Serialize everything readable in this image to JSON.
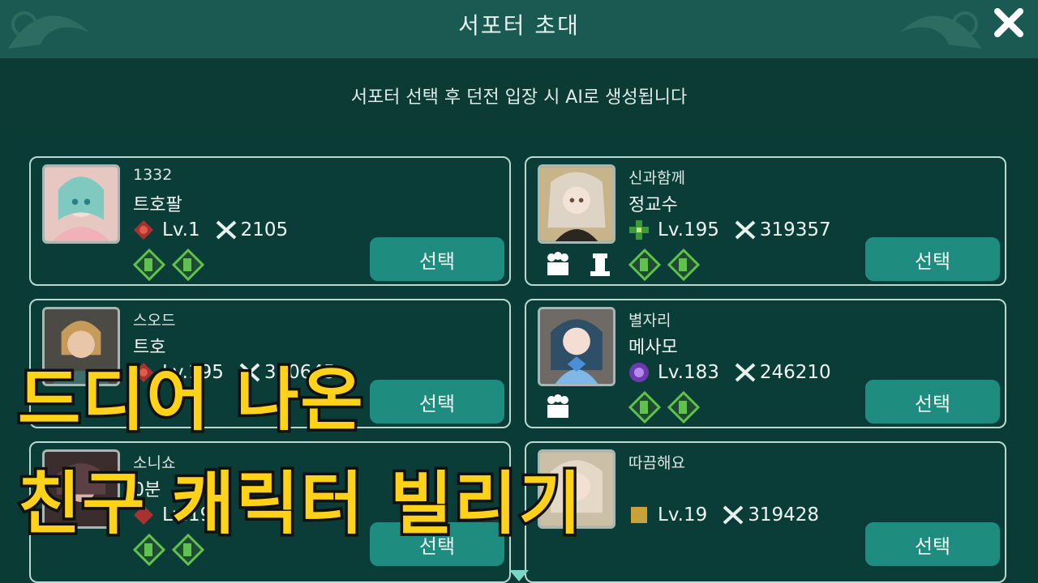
{
  "header": {
    "title": "서포터 초대",
    "close_icon": "close-icon"
  },
  "subtitle": "서포터 선택 후 던전 입장 시 AI로 생성됩니다",
  "cards": [
    {
      "guild": "1332",
      "name": "트호팔",
      "level": "Lv.1",
      "power": "2105",
      "select_label": "선택",
      "class_color": "#a8322f"
    },
    {
      "guild": "신과함께",
      "name": "정교수",
      "level": "Lv.195",
      "power": "319357",
      "select_label": "선택",
      "class_color": "#3c9a3a"
    },
    {
      "guild": "스오드",
      "name": "트호",
      "level": "Lv.195",
      "power": "310645",
      "select_label": "선택",
      "class_color": "#a8322f"
    },
    {
      "guild": "별자리",
      "name": "메사모",
      "level": "Lv.183",
      "power": "246210",
      "select_label": "선택",
      "class_color": "#6a3ab0"
    },
    {
      "guild": "소니쇼",
      "name": "0분",
      "level": "Lv.19",
      "power": "",
      "select_label": "선택",
      "class_color": "#a8322f"
    },
    {
      "guild": "따끔해요",
      "name": "",
      "level": "Lv.19",
      "power": "319428",
      "select_label": "선택",
      "class_color": "#c9a13a"
    }
  ],
  "overlay_caption": {
    "line1": "드디어 나온",
    "line2": "친구 캐릭터 빌리기"
  },
  "colors": {
    "accent_button": "#1e8c7e",
    "caption_fill": "#ffd21a",
    "diamond_green": "#5fc24a"
  }
}
